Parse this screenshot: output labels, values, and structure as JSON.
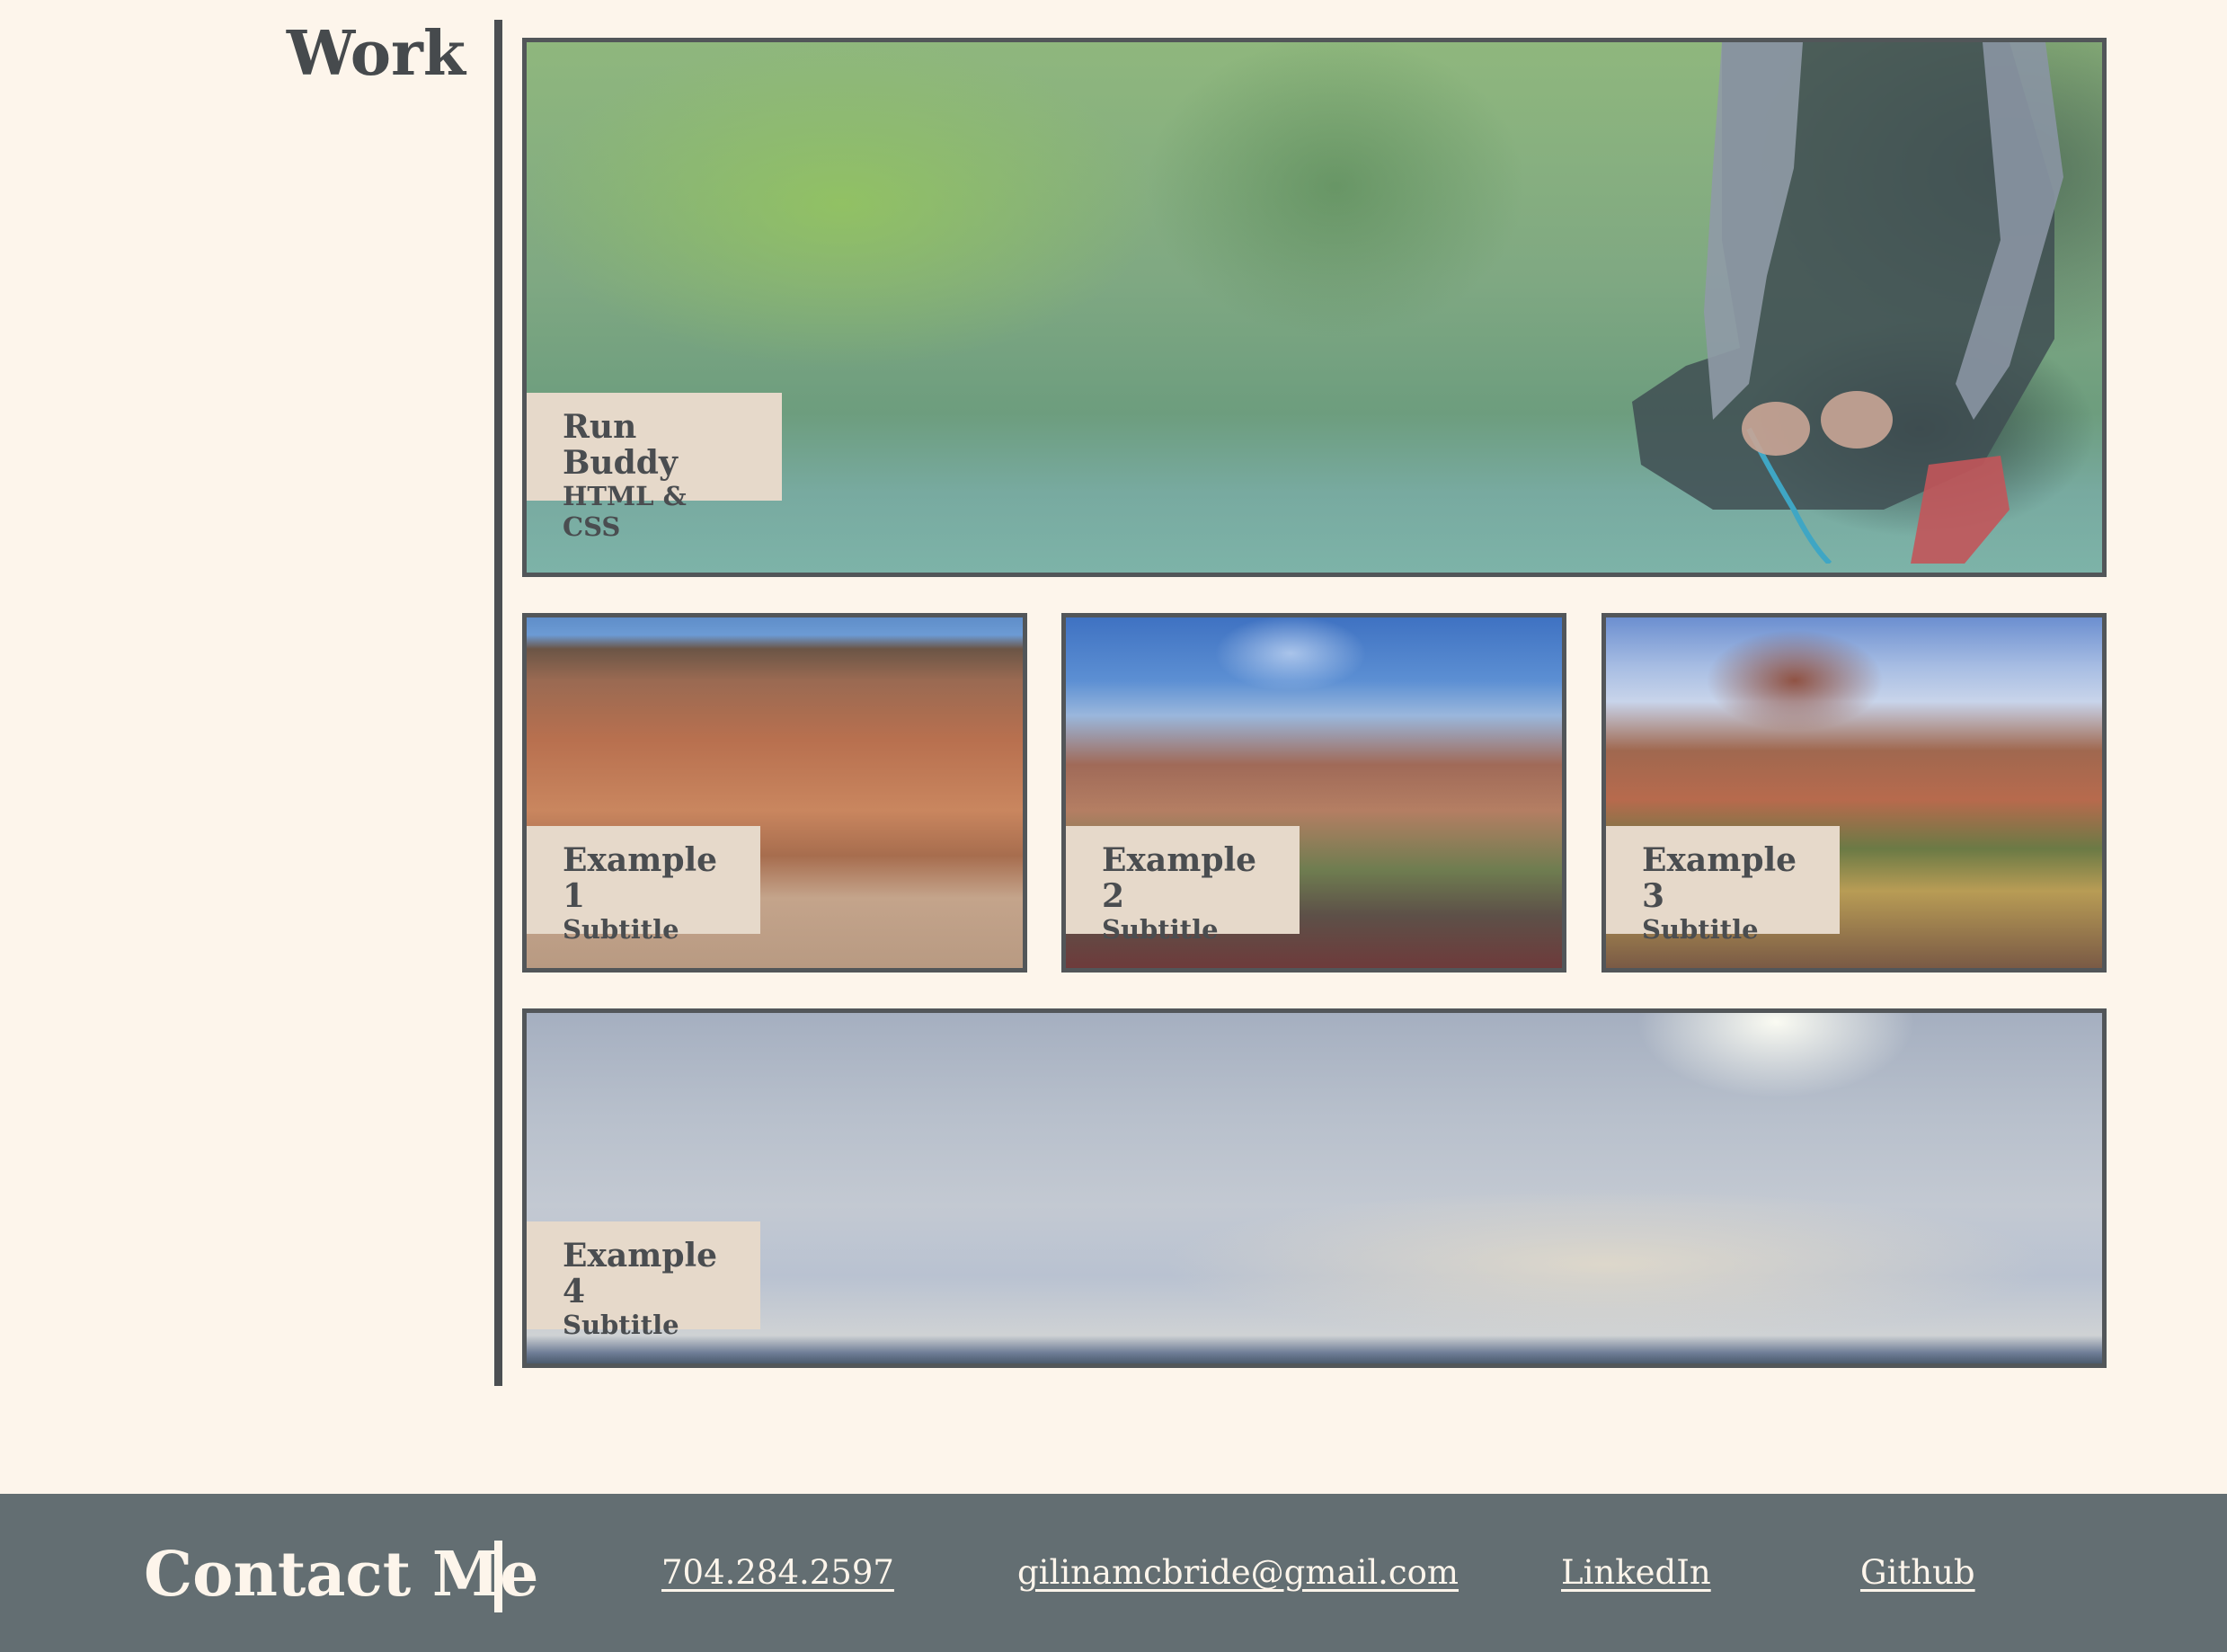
{
  "work": {
    "title": "Work",
    "featured": {
      "title": "Run Buddy",
      "subtitle": "HTML & CSS"
    },
    "projects": [
      {
        "title": "Example 1",
        "subtitle": "Subtitle"
      },
      {
        "title": "Example 2",
        "subtitle": "Subtitle"
      },
      {
        "title": "Example 3",
        "subtitle": "Subtitle"
      },
      {
        "title": "Example 4",
        "subtitle": "Subtitle"
      }
    ]
  },
  "footer": {
    "title": "Contact Me",
    "links": {
      "phone": "704.284.2597",
      "email": "gilinamcbride@gmail.com",
      "linkedin": "LinkedIn",
      "github": "Github"
    }
  },
  "colors": {
    "page_background": "#fdf5eb",
    "text_dark": "#464a4d",
    "label_background": "#e6d9ca",
    "footer_background": "#636e72"
  }
}
